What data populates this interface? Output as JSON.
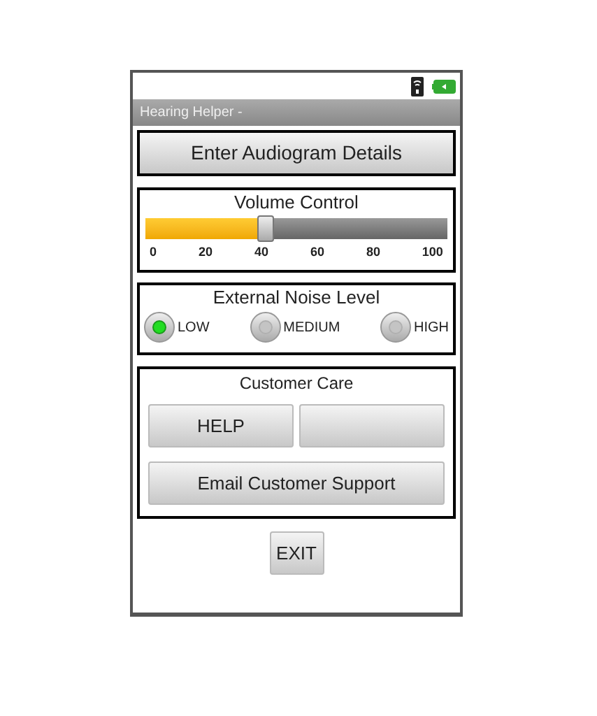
{
  "window": {
    "title": "Hearing Helper -"
  },
  "audiogram_button": {
    "label": "Enter Audiogram Details"
  },
  "volume": {
    "title": "Volume Control",
    "level": 0.4,
    "ticks": [
      "0",
      "20",
      "40",
      "60",
      "80",
      "100"
    ]
  },
  "noise": {
    "title": "External Noise Level",
    "options": [
      {
        "label": "LOW",
        "selected": true
      },
      {
        "label": "MEDIUM",
        "selected": false
      },
      {
        "label": "HIGH",
        "selected": false
      }
    ]
  },
  "customer_care": {
    "title": "Customer Care",
    "buttons": [
      {
        "kind": "labeled",
        "label": "HELP"
      },
      {
        "kind": "blank"
      }
    ],
    "email_button": {
      "label": "Email Customer Support"
    }
  },
  "exit_button": {
    "label": "EXIT"
  }
}
